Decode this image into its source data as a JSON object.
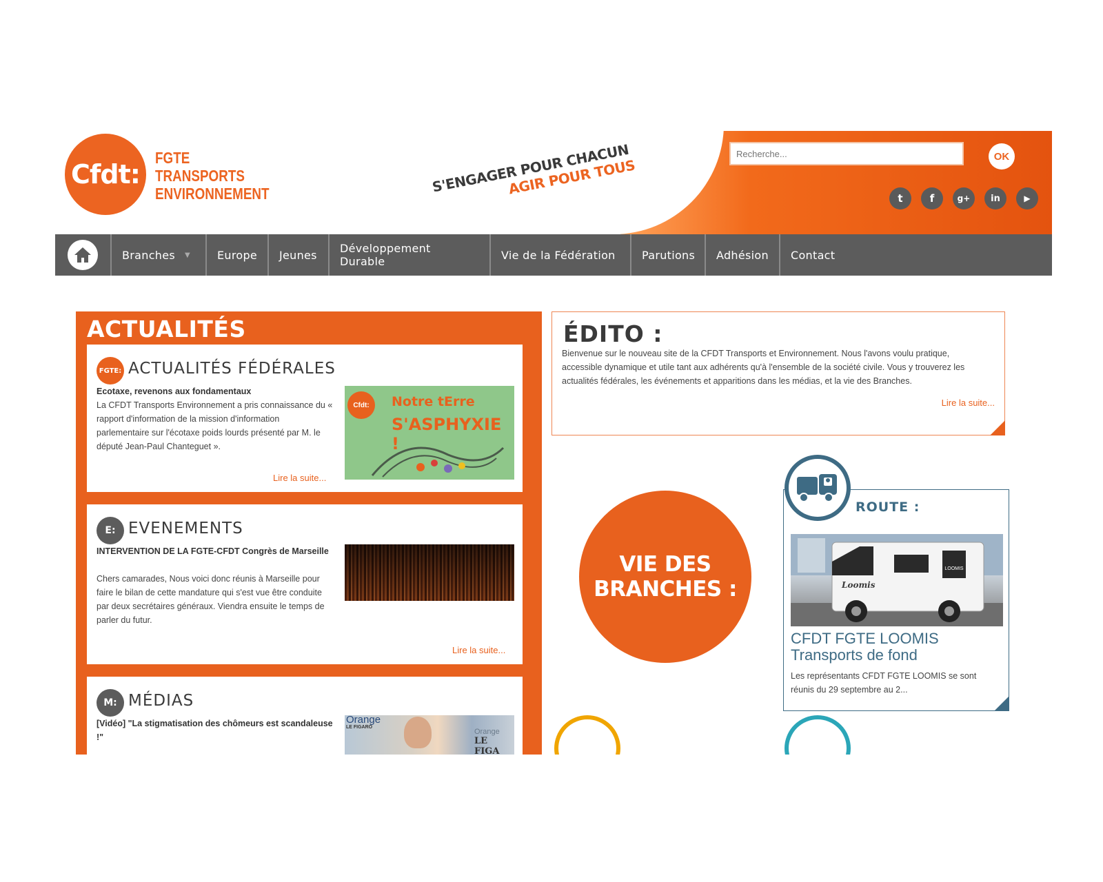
{
  "brand": {
    "logo": "Cfdt:",
    "name_lines": [
      "FGTE",
      "TRANSPORTS",
      "ENVIRONNEMENT"
    ],
    "slogan_1": "S'ENGAGER POUR CHACUN",
    "slogan_2": "AGIR POUR TOUS",
    "accent_color": "#e8611e",
    "nav_color": "#5c5c5c",
    "route_color": "#3e6b84"
  },
  "search": {
    "placeholder": "Recherche...",
    "ok_label": "OK"
  },
  "socials": [
    {
      "icon": "twitter-icon",
      "glyph": "t"
    },
    {
      "icon": "facebook-icon",
      "glyph": "f"
    },
    {
      "icon": "google-plus-icon",
      "glyph": "g+"
    },
    {
      "icon": "linkedin-icon",
      "glyph": "in"
    },
    {
      "icon": "youtube-icon",
      "glyph": "▶"
    }
  ],
  "nav": {
    "home_icon": "home-icon",
    "items": [
      "Branches",
      "Europe",
      "Jeunes",
      "Développement Durable",
      "Vie de la Fédération",
      "Parutions",
      "Adhésion",
      "Contact"
    ]
  },
  "actus": {
    "title": "ACTUALITÉS",
    "federales": {
      "badge": "FGTE:",
      "title": "ACTUALITÉS FÉDÉRALES",
      "article_title": "Ecotaxe, revenons aux fondamentaux",
      "article_body": "La CFDT Transports Environnement a pris connaissance du « rapport d'information de la mission d'information parlementaire sur l'écotaxe poids lourds présenté par M. le député Jean-Paul Chanteguet ».",
      "read_more": "Lire la suite...",
      "image_logo": "Cfdt:",
      "image_line_1": "Notre tErre",
      "image_line_2": "S'ASPHYXIE !"
    },
    "evenements": {
      "badge": "E:",
      "title": "EVENEMENTS",
      "article_title": "INTERVENTION DE LA FGTE-CFDT Congrès de Marseille",
      "article_body": "Chers camarades, Nous voici donc réunis à Marseille pour faire le bilan de cette mandature qui s'est vue être conduite par deux secrétaires généraux. Viendra ensuite le temps de parler du futur.",
      "read_more": "Lire la suite..."
    },
    "medias": {
      "badge": "M:",
      "title": "MÉDIAS",
      "article_title": "[Vidéo] \"La stigmatisation des chômeurs est scandaleuse !\"",
      "image_text_1": "Orange",
      "image_text_2": "LE FIGARO",
      "image_text_3": "Orange",
      "image_text_4": "LE FIGA"
    }
  },
  "edito": {
    "title": "ÉDITO :",
    "text": "Bienvenue sur le nouveau site de la CFDT Transports et Environnement. Nous l'avons voulu pratique, accessible dynamique et utile tant aux adhérents qu'à l'ensemble de la société civile. Vous y trouverez les actualités fédérales, les événements et apparitions dans les médias, et la vie des Branches.",
    "read_more": "Lire la suite..."
  },
  "vie_des_branches": {
    "line_1": "VIE DES",
    "line_2": "BRANCHES :"
  },
  "route": {
    "icon": "truck-icon",
    "title": "ROUTE :",
    "headline_1": "CFDT FGTE LOOMIS",
    "headline_2": "Transports de fond",
    "text": "Les représentants CFDT FGTE LOOMIS se sont réunis du 29 septembre au 2...",
    "photo_brand": "LOOMIS",
    "photo_side": "Loomis"
  }
}
